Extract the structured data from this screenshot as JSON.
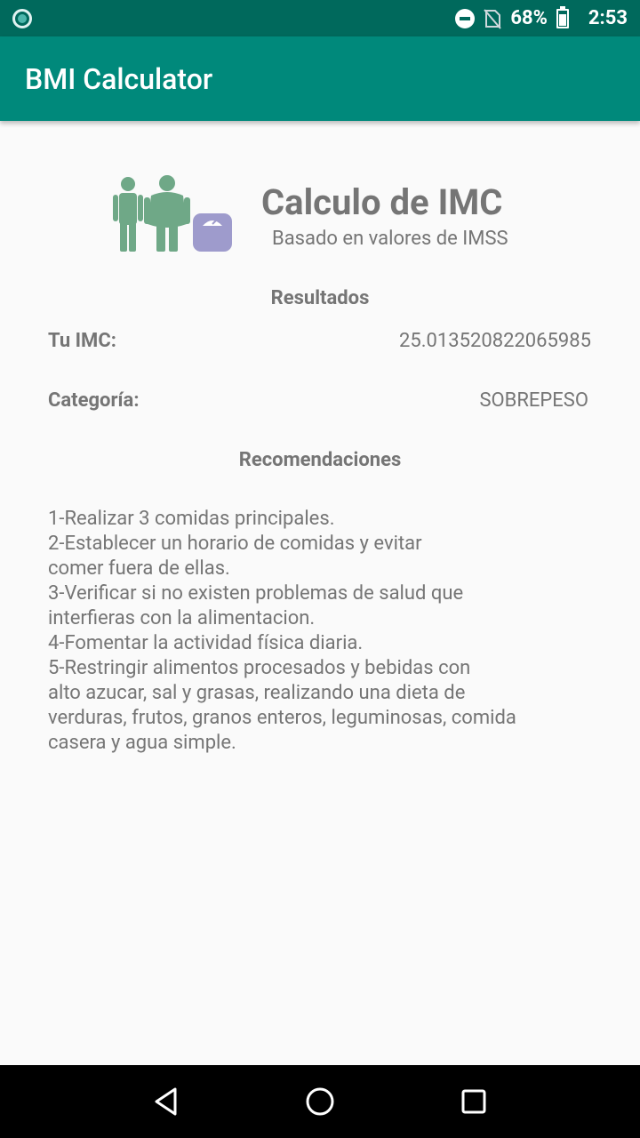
{
  "status_bar": {
    "battery": "68%",
    "time": "2:53"
  },
  "app_bar": {
    "title": "BMI Calculator"
  },
  "header": {
    "title": "Calculo de IMC",
    "subtitle": "Basado en valores de IMSS"
  },
  "results": {
    "heading": "Resultados",
    "imc_label": "Tu IMC:",
    "imc_value": "25.013520822065985",
    "category_label": "Categoría:",
    "category_value": "SOBREPESO"
  },
  "recommendations": {
    "heading": "Recomendaciones",
    "text": "1-Realizar 3 comidas principales.\n2-Establecer un horario de comidas y evitar\ncomer fuera de ellas.\n3-Verificar si no existen problemas de salud que\ninterfieras con la alimentacion.\n4-Fomentar la actividad física diaria.\n5-Restringir alimentos procesados y bebidas con\nalto azucar, sal y grasas, realizando una dieta de\nverduras, frutos, granos enteros, leguminosas, comida\ncasera y agua simple."
  },
  "colors": {
    "status_bar": "#00695c",
    "app_bar": "#00897b",
    "text": "#757575",
    "figure_green": "#6fa887",
    "scale_purple": "#9e9bcc"
  },
  "icons": [
    "notification-icon",
    "do-not-disturb-icon",
    "no-sim-icon",
    "battery-icon",
    "people-scale-icon",
    "back-icon",
    "home-icon",
    "recents-icon"
  ]
}
